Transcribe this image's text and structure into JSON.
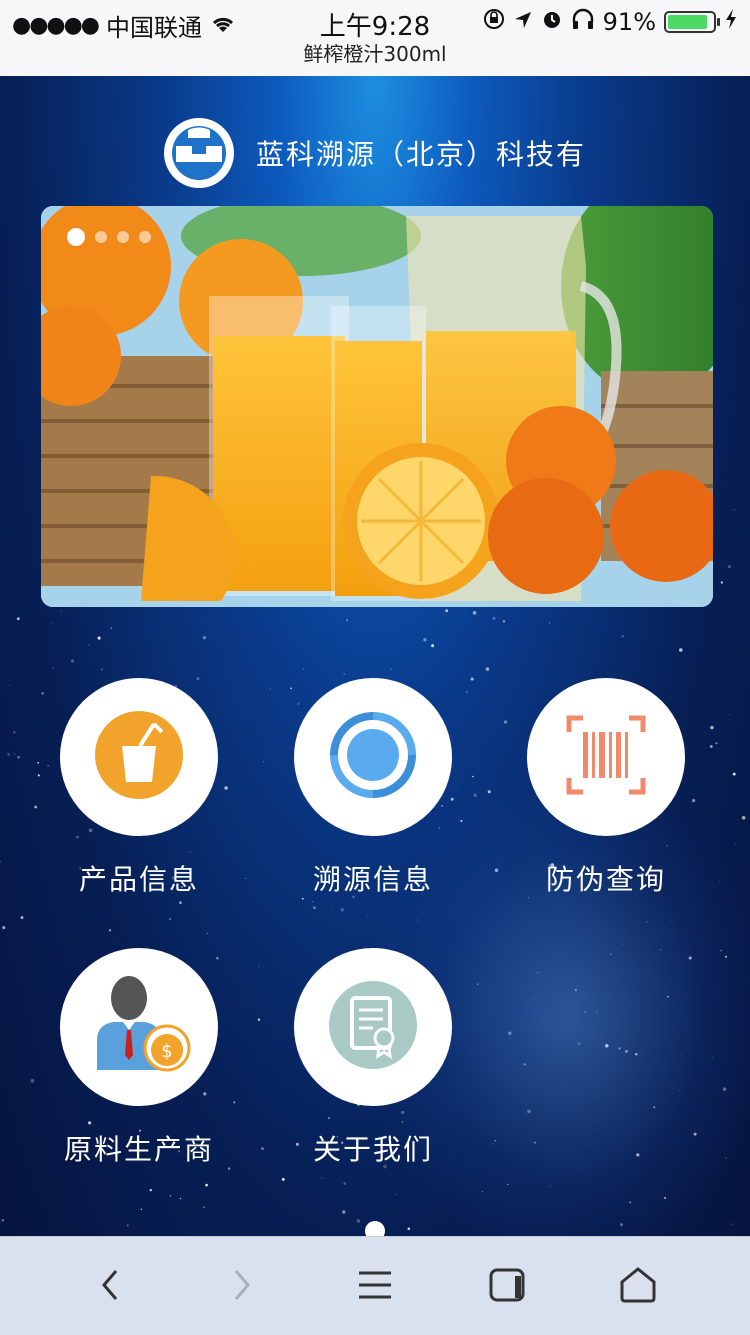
{
  "status_bar": {
    "carrier": "中国联通",
    "time": "上午9:28",
    "battery_percent": "91%",
    "battery_level": 0.91
  },
  "page_title": "鲜榨橙汁300ml",
  "header": {
    "company_name": "蓝科溯源（北京）科技有"
  },
  "banner": {
    "slide_count": 4,
    "active_slide": 0
  },
  "menu": {
    "items": [
      {
        "label": "产品信息",
        "icon": "juice-cup-icon",
        "color": "#f2a32c"
      },
      {
        "label": "溯源信息",
        "icon": "trace-cycle-icon",
        "color": "#3aa0f0"
      },
      {
        "label": "防伪查询",
        "icon": "barcode-scan-icon",
        "color": "#f08a6a"
      },
      {
        "label": "原料生产商",
        "icon": "producer-icon",
        "color": "#f2a32c"
      },
      {
        "label": "关于我们",
        "icon": "certificate-icon",
        "color": "#a9c9c4"
      }
    ]
  },
  "pager": {
    "pages": 1,
    "active": 0
  },
  "browser_bar": {
    "buttons": [
      "back",
      "forward",
      "menu",
      "tabs",
      "home"
    ]
  }
}
